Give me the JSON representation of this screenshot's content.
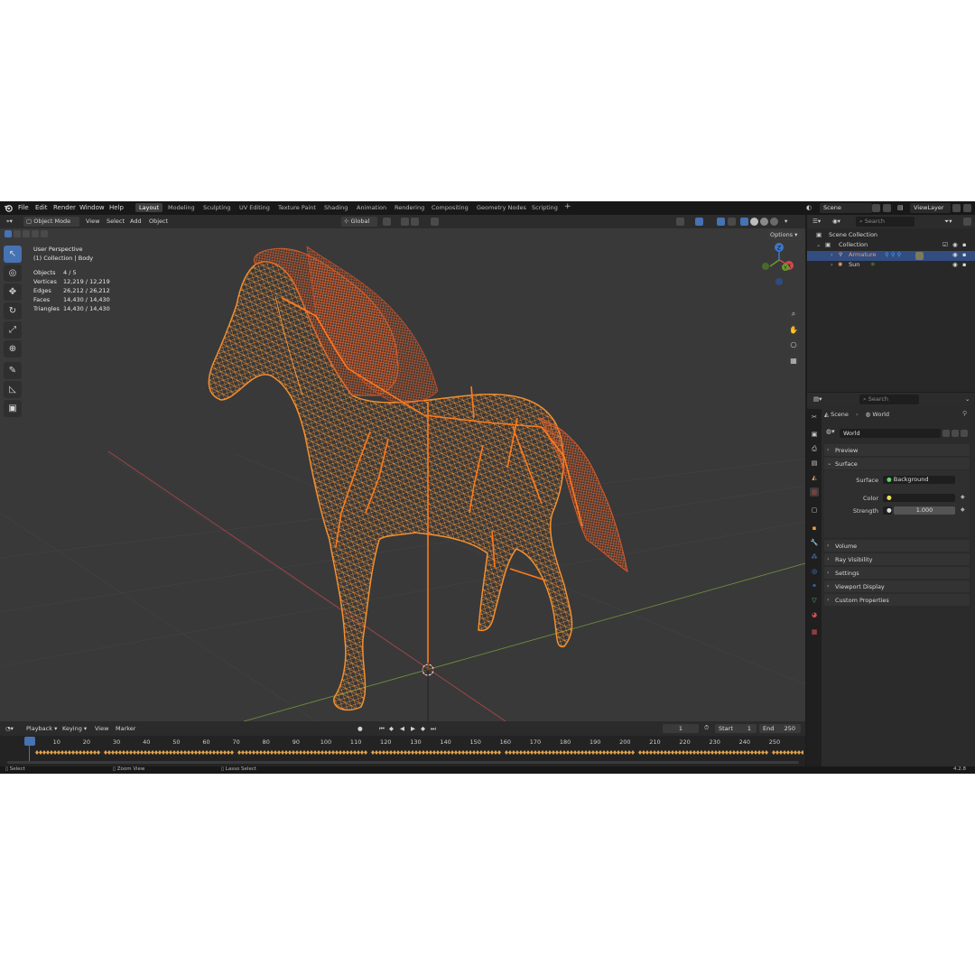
{
  "menu": [
    "File",
    "Edit",
    "Render",
    "Window",
    "Help"
  ],
  "workspaces": [
    "Layout",
    "Modeling",
    "Sculpting",
    "UV Editing",
    "Texture Paint",
    "Shading",
    "Animation",
    "Rendering",
    "Compositing",
    "Geometry Nodes",
    "Scripting"
  ],
  "scene_name": "Scene",
  "view_layer": "ViewLayer",
  "viewport_header": {
    "mode": "Object Mode",
    "menus": [
      "View",
      "Select",
      "Add",
      "Object"
    ],
    "transform_orientation": "Global",
    "options_label": "Options"
  },
  "viewport_overlay": {
    "perspective": "User Perspective",
    "collection_info": "(1) Collection | Body",
    "stats": [
      {
        "label": "Objects",
        "value": "4 / 5"
      },
      {
        "label": "Vertices",
        "value": "12,219 / 12,219"
      },
      {
        "label": "Edges",
        "value": "26,212 / 26,212"
      },
      {
        "label": "Faces",
        "value": "14,430 / 14,430"
      },
      {
        "label": "Triangles",
        "value": "14,430 / 14,430"
      }
    ]
  },
  "gizmo_axes": {
    "x": "X",
    "y": "Y",
    "z": "Z"
  },
  "timeline": {
    "menus": [
      "Playback",
      "Keying",
      "View",
      "Marker"
    ],
    "current_frame": "1",
    "start_label": "Start",
    "start": "1",
    "end_label": "End",
    "end": "250",
    "ticks": [
      "1",
      "10",
      "20",
      "30",
      "40",
      "50",
      "60",
      "70",
      "80",
      "90",
      "100",
      "110",
      "120",
      "130",
      "140",
      "150",
      "160",
      "170",
      "180",
      "190",
      "200",
      "210",
      "220",
      "230",
      "240",
      "250"
    ]
  },
  "statusbar": {
    "select": "Select",
    "zoom": "Zoom View",
    "lasso": "Lasso Select",
    "version": "4.2.8"
  },
  "outliner": {
    "search_placeholder": "Search",
    "scene_collection": "Scene Collection",
    "collection": "Collection",
    "armature": "Armature",
    "sun": "Sun"
  },
  "properties": {
    "search_placeholder": "Search",
    "breadcrumb_scene": "Scene",
    "breadcrumb_world": "World",
    "world_name": "World",
    "panels": {
      "preview": "Preview",
      "surface": "Surface",
      "volume": "Volume",
      "ray_visibility": "Ray Visibility",
      "settings": "Settings",
      "viewport_display": "Viewport Display",
      "custom_properties": "Custom Properties"
    },
    "surface_label": "Surface",
    "surface_value": "Background",
    "color_label": "Color",
    "strength_label": "Strength",
    "strength_value": "1.000"
  },
  "colors": {
    "accent": "#4772b3",
    "wire": "#ff8a2a",
    "bone": "#ff7a1a",
    "x_axis": "#d8454f",
    "y_axis": "#6a9a2c",
    "z_axis": "#3f76c8"
  }
}
